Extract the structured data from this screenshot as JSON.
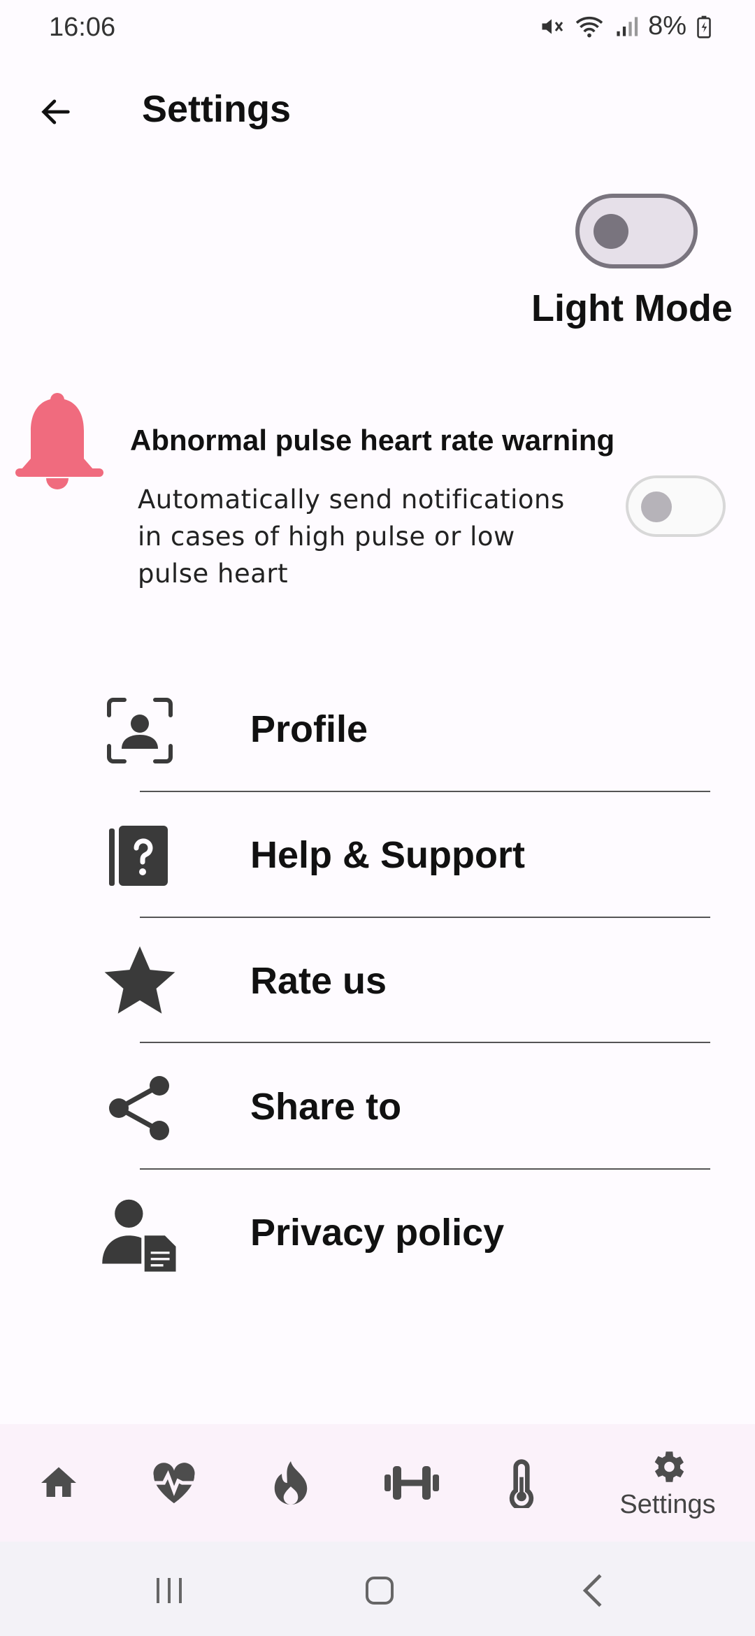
{
  "status_bar": {
    "time": "16:06",
    "battery": "8%"
  },
  "app_bar": {
    "title": "Settings"
  },
  "theme": {
    "label": "Light Mode",
    "enabled": false
  },
  "heart_rate_warning": {
    "title": "Abnormal pulse heart rate warning",
    "description": "Automatically send notifications in cases of high pulse or low pulse heart",
    "enabled": false,
    "icon": "bell-icon",
    "icon_color": "#f06b7e"
  },
  "menu": [
    {
      "label": "Profile",
      "icon": "profile-scan-icon"
    },
    {
      "label": "Help & Support",
      "icon": "help-book-icon"
    },
    {
      "label": "Rate us",
      "icon": "star-icon"
    },
    {
      "label": "Share to",
      "icon": "share-icon"
    },
    {
      "label": "Privacy policy",
      "icon": "privacy-user-document-icon"
    }
  ],
  "bottom_nav": {
    "items": [
      {
        "icon": "home-icon"
      },
      {
        "icon": "heart-pulse-icon"
      },
      {
        "icon": "flame-icon"
      },
      {
        "icon": "dumbbell-icon"
      },
      {
        "icon": "thermometer-icon"
      },
      {
        "icon": "gear-icon",
        "label": "Settings",
        "active": true
      }
    ]
  },
  "colors": {
    "background": "#fefbff",
    "bottom_nav_bg": "#fbf2fa",
    "icon_gray": "#4d4d4d",
    "toggle_track": "#e6e0e9",
    "toggle_outline": "#79747e"
  }
}
